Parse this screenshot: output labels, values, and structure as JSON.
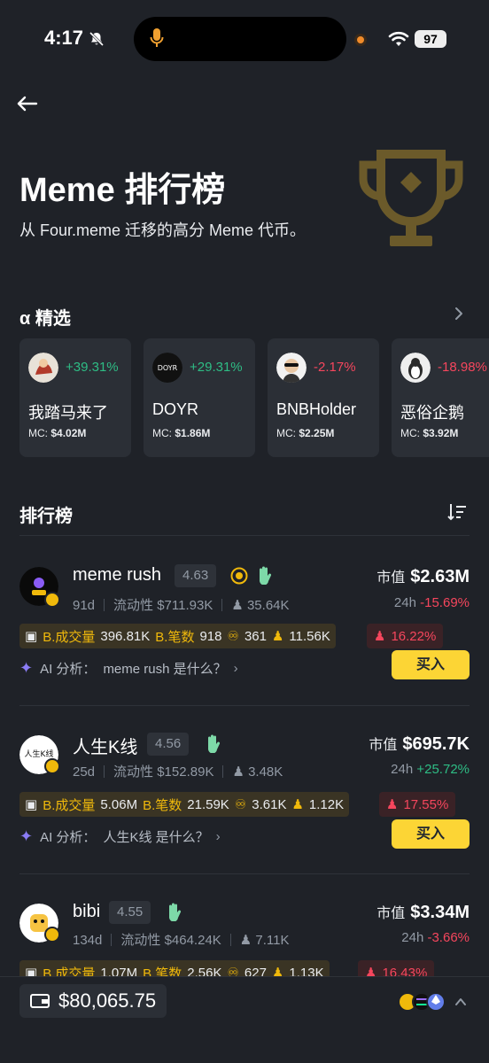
{
  "status": {
    "time": "4:17",
    "battery": "97"
  },
  "hero": {
    "title": "Meme 排行榜",
    "subtitle": "从 Four.meme 迁移的高分 Meme 代币。"
  },
  "alpha": {
    "title": "α 精选",
    "mc_label": "MC:",
    "cards": [
      {
        "change": "+39.31%",
        "direction": "up",
        "name": "我踏马来了",
        "mc": "$4.02M"
      },
      {
        "change": "+29.31%",
        "direction": "up",
        "name": "DOYR",
        "mc": "$1.86M",
        "logo_text": "DOYR"
      },
      {
        "change": "-2.17%",
        "direction": "down",
        "name": "BNBHolder",
        "mc": "$2.25M"
      },
      {
        "change": "-18.98%",
        "direction": "down",
        "name": "恶俗企鹅",
        "mc": "$3.92M"
      }
    ]
  },
  "ranking": {
    "title": "排行榜",
    "mcap_label": "市值",
    "h24_label": "24h",
    "liquidity_label": "流动性",
    "b_volume_label": "B.成交量",
    "b_tx_label": "B.笔数",
    "ai_prefix": "AI 分析：",
    "buy_label": "买入",
    "tokens": [
      {
        "name": "meme rush",
        "score": "4.63",
        "age": "91d",
        "liquidity": "$711.93K",
        "holders": "35.64K",
        "mcap": "$2.63M",
        "change_24h": "-15.69%",
        "direction": "down",
        "b_volume": "396.81K",
        "b_tx": "918",
        "traders": "361",
        "users": "11.56K",
        "top_pct": "16.22%",
        "ai_text": "meme rush 是什么？"
      },
      {
        "name": "人生K线",
        "score": "4.56",
        "age": "25d",
        "liquidity": "$152.89K",
        "holders": "3.48K",
        "mcap": "$695.7K",
        "change_24h": "+25.72%",
        "direction": "up",
        "b_volume": "5.06M",
        "b_tx": "21.59K",
        "traders": "3.61K",
        "users": "1.12K",
        "top_pct": "17.55%",
        "ai_text": "人生K线 是什么？",
        "logo_text": "人生K线"
      },
      {
        "name": "bibi",
        "score": "4.55",
        "age": "134d",
        "liquidity": "$464.24K",
        "holders": "7.11K",
        "mcap": "$3.34M",
        "change_24h": "-3.66%",
        "direction": "down",
        "b_volume": "1.07M",
        "b_tx": "2.56K",
        "traders": "627",
        "users": "1.13K",
        "top_pct": "16.43%"
      }
    ]
  },
  "wallet": {
    "balance": "$80,065.75"
  },
  "colors": {
    "up": "#2ebd85",
    "down": "#f6465d",
    "accent": "#fcd535",
    "background": "#1f2228"
  }
}
